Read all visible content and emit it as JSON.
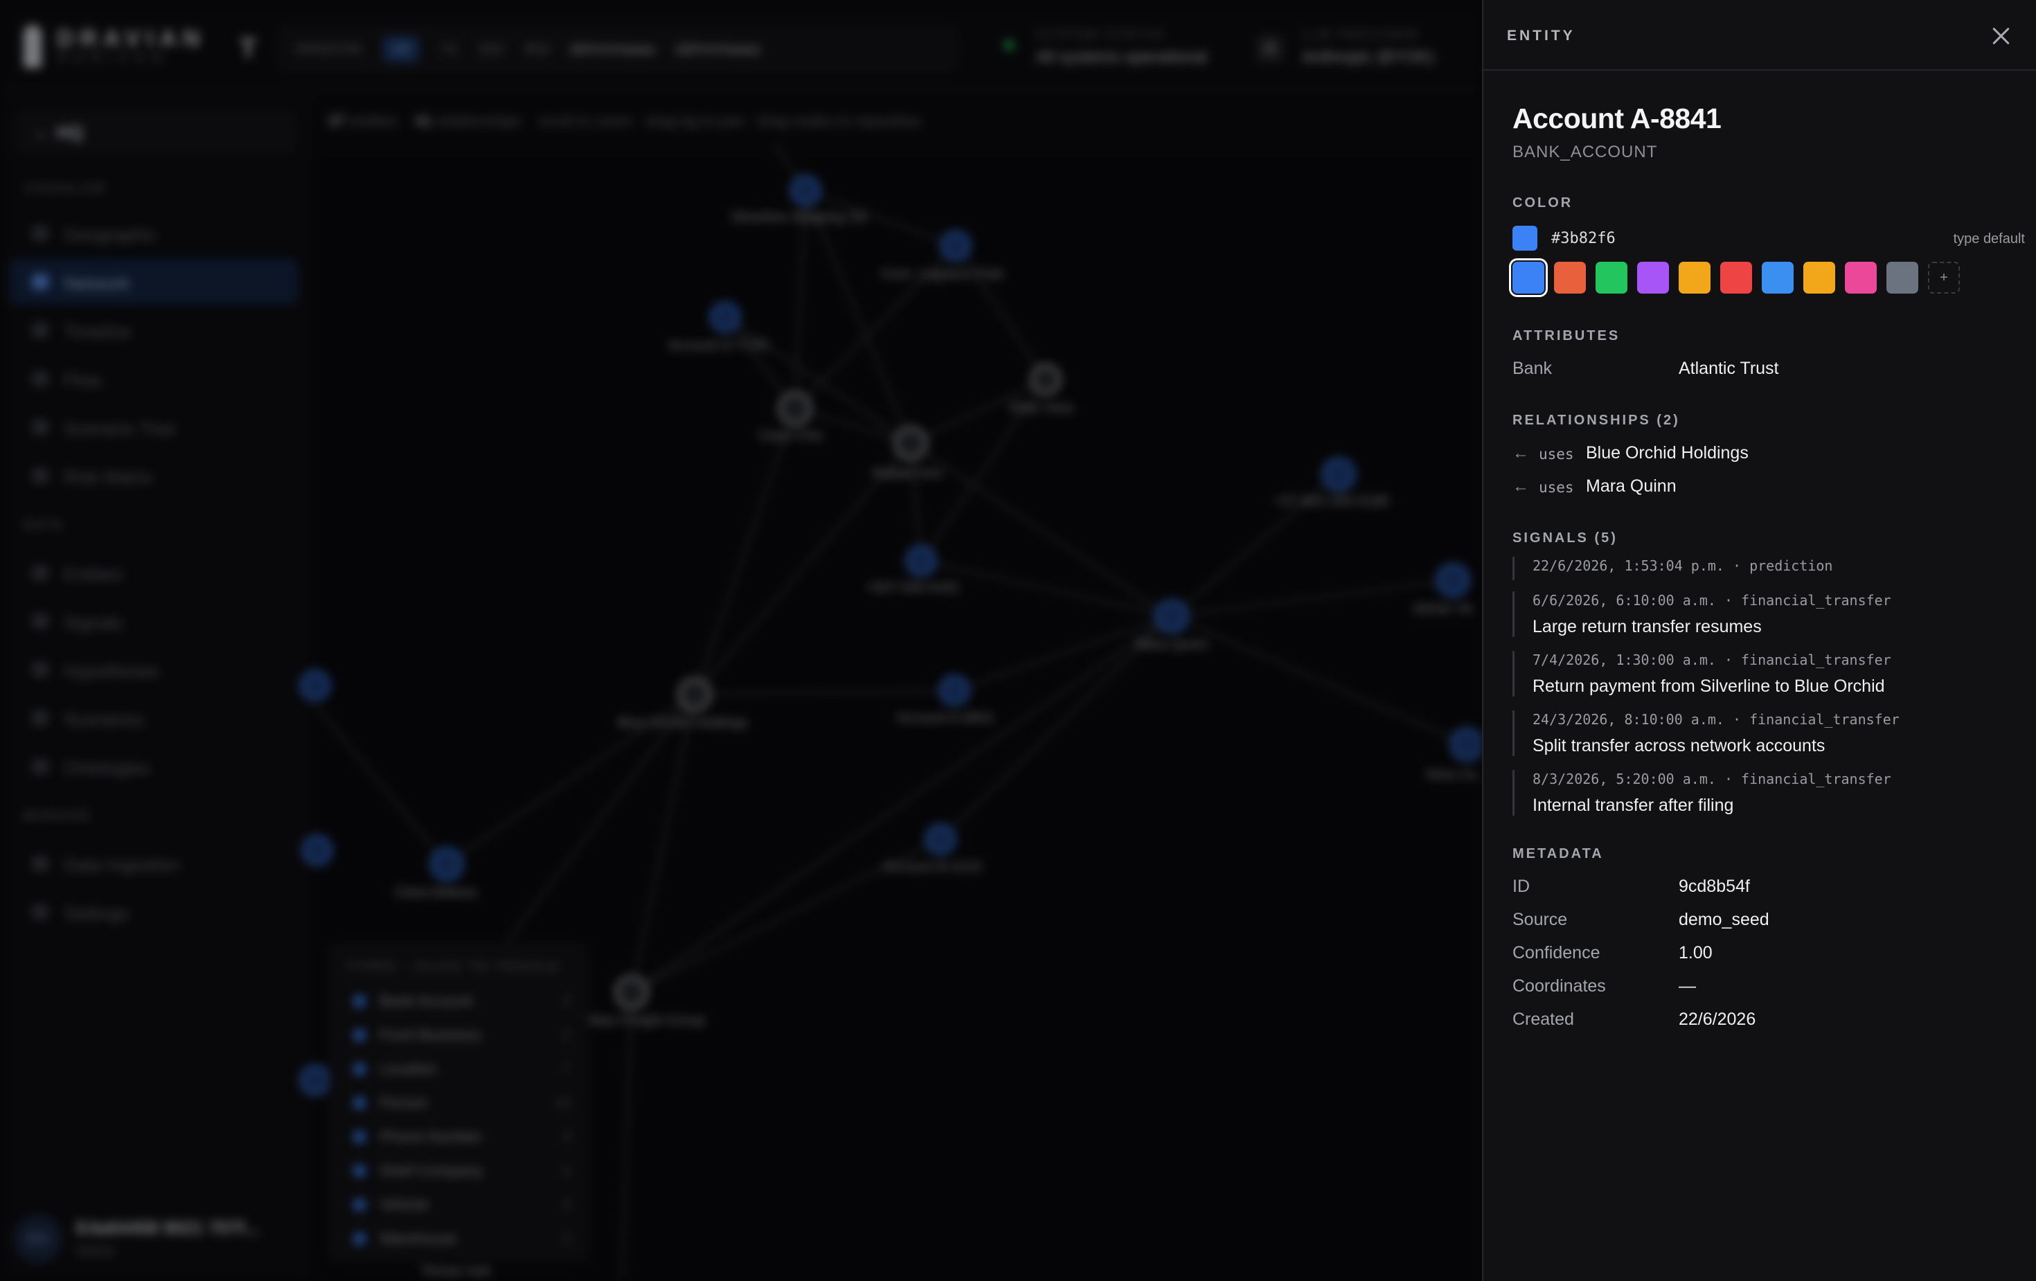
{
  "background": {
    "brand": {
      "name": "DRAVIAN",
      "sub": "HORIZON"
    },
    "window": {
      "label": "WINDOW",
      "ranges": [
        "All",
        "7d",
        "30d",
        "90d"
      ],
      "from": "dd/mm/aaaa",
      "to": "dd/mm/aaaa"
    },
    "system_status": {
      "label": "SYSTEM STATUS",
      "value": "All systems operational"
    },
    "llm_provider": {
      "label": "LLM PROVIDER",
      "value": "Anthropic (BYOK)"
    },
    "sidebar": {
      "hq": "HQ",
      "visualize_label": "VISUALIZE",
      "visualize": [
        "Geographic",
        "Network",
        "Timeline",
        "Flow",
        "Scenario Tree",
        "Risk Matrix"
      ],
      "data_label": "DATA",
      "data": [
        "Entities",
        "Signals",
        "Hypotheses",
        "Scenarios",
        "Ontologies"
      ],
      "manage_label": "MANAGE",
      "manage": [
        "Data Ingestion",
        "Settings"
      ],
      "user": {
        "initials": "EA",
        "name": "E4a64458 9021 707f...",
        "role": "Admin"
      }
    },
    "canvas_head": {
      "entities": "37",
      "entities_label": "entities",
      "relationships": "41",
      "relationships_label": "relationships",
      "hint": "scroll to zoom · drag bg to pan · drag nodes to reposition"
    },
    "legend": {
      "title": "TYPES · CLICK TO TOGGLE",
      "items": [
        {
          "label": "Bank Account",
          "count": "4"
        },
        {
          "label": "Front Business",
          "count": "2"
        },
        {
          "label": "Location",
          "count": "7"
        },
        {
          "label": "Person",
          "count": "10"
        },
        {
          "label": "Phone Number",
          "count": "4"
        },
        {
          "label": "Shell Company",
          "count": "4"
        },
        {
          "label": "Vehicle",
          "count": "3"
        },
        {
          "label": "Warehouse",
          "count": "2"
        }
      ]
    }
  },
  "panel": {
    "header": "ENTITY",
    "title": "Account A-8841",
    "type": "BANK_ACCOUNT",
    "color_label": "COLOR",
    "color": {
      "hex": "#3b82f6",
      "note": "type default"
    },
    "swatches": [
      "#3b82f6",
      "#e8603c",
      "#22c55e",
      "#a855f7",
      "#f2a71b",
      "#ef4444",
      "#3b8ff0",
      "#f2a71b",
      "#ec4899",
      "#6b7280"
    ],
    "swatch_add": "+",
    "attributes_label": "ATTRIBUTES",
    "attributes": [
      {
        "key": "Bank",
        "value": "Atlantic Trust"
      }
    ],
    "relationships_label": "RELATIONSHIPS (2)",
    "relationships": [
      {
        "arrow": "←",
        "verb": "uses",
        "target": "Blue Orchid Holdings"
      },
      {
        "arrow": "←",
        "verb": "uses",
        "target": "Mara Quinn"
      }
    ],
    "signals_label": "SIGNALS (5)",
    "signals": [
      {
        "meta": "22/6/2026, 1:53:04 p.m. · prediction",
        "text": ""
      },
      {
        "meta": "6/6/2026, 6:10:00 a.m. · financial_transfer",
        "text": "Large return transfer resumes"
      },
      {
        "meta": "7/4/2026, 1:30:00 a.m. · financial_transfer",
        "text": "Return payment from Silverline to Blue Orchid"
      },
      {
        "meta": "24/3/2026, 8:10:00 a.m. · financial_transfer",
        "text": "Split transfer across network accounts"
      },
      {
        "meta": "8/3/2026, 5:20:00 a.m. · financial_transfer",
        "text": "Internal transfer after filing"
      }
    ],
    "metadata_label": "METADATA",
    "metadata": [
      {
        "key": "ID",
        "value": "9cd8b54f"
      },
      {
        "key": "Source",
        "value": "demo_seed"
      },
      {
        "key": "Confidence",
        "value": "1.00"
      },
      {
        "key": "Coordinates",
        "value": "—"
      },
      {
        "key": "Created",
        "value": "22/6/2026"
      }
    ]
  }
}
